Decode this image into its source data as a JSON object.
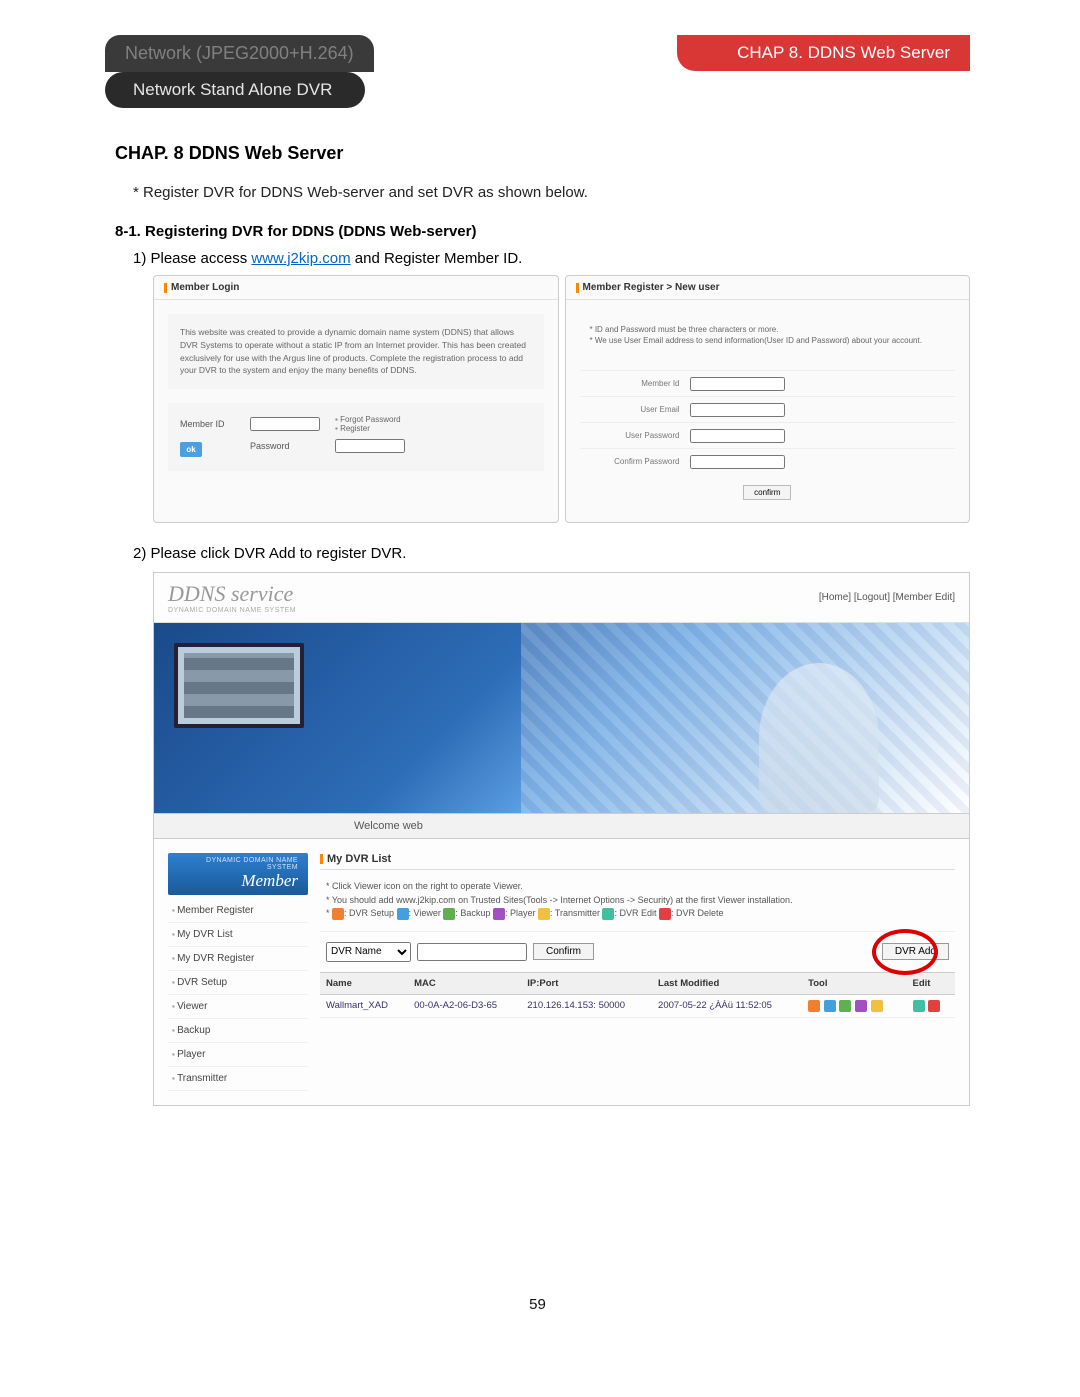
{
  "header": {
    "tab_left": "Network (JPEG2000+H.264)",
    "tab_right": "CHAP 8. DDNS Web Server",
    "tab_sub": "Network Stand Alone DVR"
  },
  "h1": "CHAP. 8   DDNS Web Server",
  "intro": "* Register DVR for DDNS Web-server and set DVR as shown below.",
  "h2": "8-1. Registering DVR for DDNS (DDNS Web-server)",
  "step1_a": "1) Please access ",
  "step1_link": "www.j2kip.com",
  "step1_b": " and Register Member ID.",
  "step2": "2) Please click DVR Add to register DVR.",
  "login": {
    "section": "Member Login",
    "blurb": "This website was created to provide a dynamic domain name system (DDNS) that allows DVR Systems to operate without a static IP from an Internet provider. This has been created exclusively for use with the Argus line of products. Complete the registration process to add your DVR to the system and enjoy the many benefits of DDNS.",
    "lbl_id": "Member ID",
    "lbl_pw": "Password",
    "ok": "ok",
    "forgot": "Forgot Password",
    "register": "Register"
  },
  "register": {
    "section": "Member Register > New user",
    "note1": "* ID and Password must be three characters or more.",
    "note2": "* We use User Email address to send information(User ID and Password) about your account.",
    "f_id": "Member Id",
    "f_email": "User Email",
    "f_pw": "User Password",
    "f_cpw": "Confirm Password",
    "confirm": "confirm"
  },
  "app": {
    "title": "DDNS service",
    "title_sub": "DYNAMIC DOMAIN NAME SYSTEM",
    "nav": "[Home] [Logout] [Member Edit]",
    "welcome": "Welcome web",
    "side_hdr_sm": "DYNAMIC DOMAIN NAME SYSTEM",
    "side_hdr_lg": "Member",
    "menu": [
      "Member Register",
      "My DVR List",
      "My DVR Register",
      "DVR Setup",
      "Viewer",
      "Backup",
      "Player",
      "Transmitter"
    ],
    "mp_title": "My DVR List",
    "hint1": "* Click Viewer icon on the right to operate Viewer.",
    "hint2": "* You should add www.j2kip.com on Trusted Sites(Tools -> Internet Options -> Security) at the first Viewer installation.",
    "hint_legend_pre": "* ",
    "lg_setup": ": DVR Setup ",
    "lg_viewer": ": Viewer ",
    "lg_backup": ": Backup ",
    "lg_player": ": Player ",
    "lg_trans": ": Transmitter ",
    "lg_edit": ": DVR Edit ",
    "lg_del": ": DVR Delete",
    "search_field": "DVR Name",
    "confirm_btn": "Confirm",
    "dvr_add": "DVR Add",
    "cols": {
      "name": "Name",
      "mac": "MAC",
      "ipport": "IP:Port",
      "lastmod": "Last Modified",
      "tool": "Tool",
      "edit": "Edit"
    },
    "row": {
      "name": "Wallmart_XAD",
      "mac": "00-0A-A2-06-D3-65",
      "ipport": "210.126.14.153: 50000",
      "lastmod": "2007-05-22 ¿ÀÀü 11:52:05"
    }
  },
  "page_num": "59"
}
